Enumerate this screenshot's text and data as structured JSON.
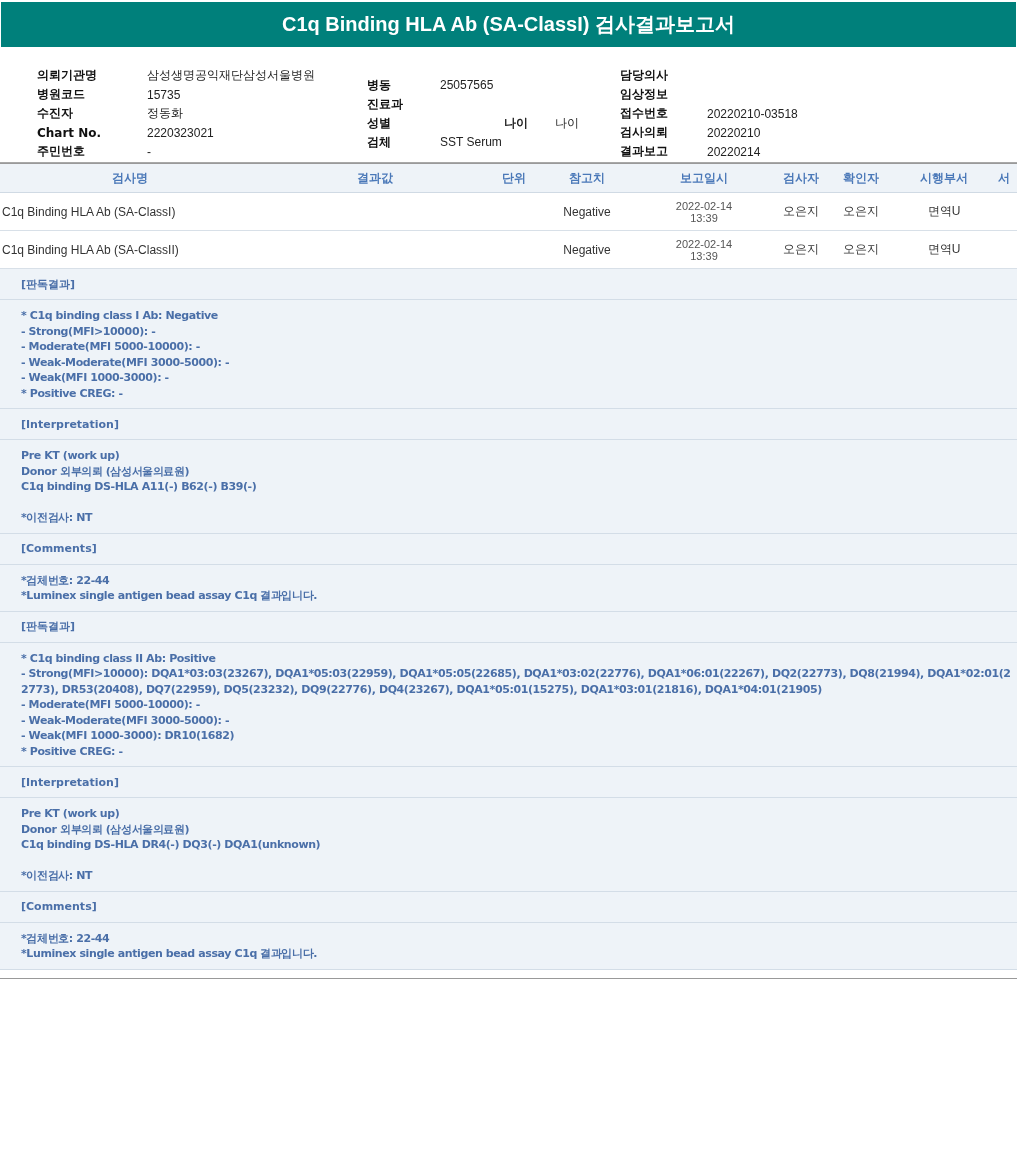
{
  "title": "C1q Binding HLA Ab (SA-ClassI) 검사결과보고서",
  "info_columns": [
    {
      "fields": [
        {
          "label": "의뢰기관명",
          "value": "삼성생명공익재단삼성서울병원"
        },
        {
          "label": "병원코드",
          "value": "15735"
        },
        {
          "label": "수진자",
          "value": "정동화"
        },
        {
          "label": "Chart No.",
          "value": "2220323021"
        },
        {
          "label": "주민번호",
          "value": "-"
        }
      ]
    },
    {
      "fields": [
        {
          "label": "병동",
          "value": "25057565"
        },
        {
          "label": "진료과"
        },
        {
          "label": "성별",
          "extra_label": "나이",
          "extra_value": "나이"
        },
        {
          "label": "검체",
          "value": "SST Serum"
        }
      ]
    },
    {
      "fields": [
        {
          "label": "담당의사"
        },
        {
          "label": "임상정보"
        },
        {
          "label": "접수번호",
          "value": "20220210-03518"
        },
        {
          "label": "검사의뢰",
          "value": "20220210"
        },
        {
          "label": "결과보고",
          "value": "20220214"
        }
      ]
    }
  ],
  "table": {
    "columns": [
      "검사명",
      "결과값",
      "단위",
      "참고치",
      "보고일시",
      "검사자",
      "확인자",
      "시행부서",
      "서"
    ],
    "rows": [
      {
        "name": "C1q Binding HLA Ab (SA-ClassI)",
        "reference": "Negative",
        "date": "2022-02-14",
        "time": "13:39",
        "tester": "오은지",
        "confirmer": "오은지",
        "department": "면역U"
      },
      {
        "name": "C1q Binding HLA Ab (SA-ClassII)",
        "reference": "Negative",
        "date": "2022-02-14",
        "time": "13:39",
        "tester": "오은지",
        "confirmer": "오은지",
        "department": "면역U"
      }
    ]
  },
  "sections": [
    {
      "kind": "heading",
      "text": "[판독결과]"
    },
    {
      "kind": "body",
      "paragraphs": [
        [
          "* C1q binding class I Ab: Negative",
          "- Strong(MFI>10000): -",
          "- Moderate(MFI 5000-10000): -",
          "- Weak-Moderate(MFI 3000-5000): -",
          "- Weak(MFI 1000-3000): -",
          "* Positive CREG: -"
        ]
      ]
    },
    {
      "kind": "heading",
      "text": "[Interpretation]"
    },
    {
      "kind": "body",
      "paragraphs": [
        [
          "Pre KT (work up)",
          "Donor 외부의뢰 (삼성서울의료원)",
          "C1q binding DS-HLA A11(-) B62(-) B39(-)"
        ],
        [
          "*이전검사: NT"
        ]
      ]
    },
    {
      "kind": "heading",
      "text": "[Comments]"
    },
    {
      "kind": "body",
      "paragraphs": [
        [
          "*검체번호: 22-44",
          "*Luminex single antigen bead assay C1q 결과입니다."
        ]
      ]
    },
    {
      "kind": "heading",
      "text": "[판독결과]"
    },
    {
      "kind": "body",
      "paragraphs": [
        [
          "* C1q binding class II Ab: Positive",
          "- Strong(MFI>10000): DQA1*03:03(23267), DQA1*05:03(22959), DQA1*05:05(22685), DQA1*03:02(22776), DQA1*06:01(22267), DQ2(22773), DQ8(21994), DQA1*02:01(2",
          "2773), DR53(20408), DQ7(22959), DQ5(23232), DQ9(22776), DQ4(23267), DQA1*05:01(15275), DQA1*03:01(21816), DQA1*04:01(21905)",
          "- Moderate(MFI 5000-10000): -",
          "- Weak-Moderate(MFI 3000-5000): -",
          "- Weak(MFI 1000-3000): DR10(1682)",
          "* Positive CREG: -"
        ]
      ]
    },
    {
      "kind": "heading",
      "text": "[Interpretation]"
    },
    {
      "kind": "body",
      "paragraphs": [
        [
          "Pre KT (work up)",
          "Donor 외부의뢰 (삼성서울의료원)",
          "C1q binding DS-HLA DR4(-) DQ3(-) DQA1(unknown)"
        ],
        [
          "*이전검사: NT"
        ]
      ]
    },
    {
      "kind": "heading",
      "text": "[Comments]"
    },
    {
      "kind": "body",
      "paragraphs": [
        [
          "*검체번호: 22-44",
          "*Luminex single antigen bead assay C1q 결과입니다."
        ]
      ]
    }
  ]
}
